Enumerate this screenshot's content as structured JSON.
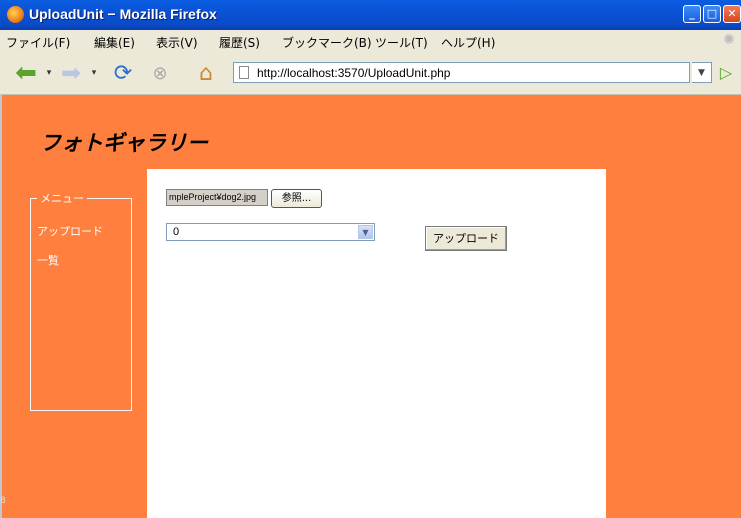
{
  "window": {
    "title": "UploadUnit − Mozilla Firefox"
  },
  "menubar": {
    "items": [
      "ファイル(F)",
      "編集(E)",
      "表示(V)",
      "履歴(S)",
      "ブックマーク(B)",
      "ツール(T)",
      "ヘルプ(H)"
    ]
  },
  "navbar": {
    "url": "http://localhost:3570/UploadUnit.php"
  },
  "page": {
    "title": "フォトギャラリー",
    "menu_legend": "メニュー",
    "menu_links": [
      "アップロード",
      "一覧"
    ],
    "file_input_value": "mpleProject¥dog2.jpg",
    "browse_label": "参照...",
    "select_value": "0",
    "upload_label": "アップロード"
  },
  "edge_label": "8",
  "colors": {
    "page_background": "#FF7F3F",
    "titlebar": "#0A52D6"
  }
}
